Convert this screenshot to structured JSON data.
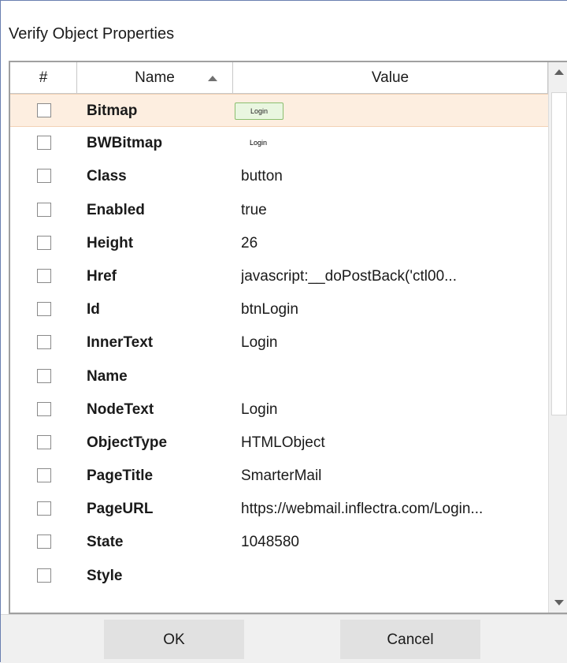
{
  "dialog": {
    "title": "Verify Object Properties"
  },
  "grid": {
    "columns": {
      "index": "#",
      "name": "Name",
      "value": "Value"
    },
    "sort": {
      "column": "Name",
      "direction": "ascending"
    },
    "rows": [
      {
        "name": "Bitmap",
        "value": "Login",
        "kind": "bitmap",
        "selected": true
      },
      {
        "name": "BWBitmap",
        "value": "Login",
        "kind": "bwbitmap"
      },
      {
        "name": "Class",
        "value": "button"
      },
      {
        "name": "Enabled",
        "value": "true"
      },
      {
        "name": "Height",
        "value": "26"
      },
      {
        "name": "Href",
        "value": "javascript:__doPostBack('ctl00..."
      },
      {
        "name": "Id",
        "value": "btnLogin"
      },
      {
        "name": "InnerText",
        "value": "Login"
      },
      {
        "name": "Name",
        "value": ""
      },
      {
        "name": "NodeText",
        "value": "Login"
      },
      {
        "name": "ObjectType",
        "value": "HTMLObject"
      },
      {
        "name": "PageTitle",
        "value": "SmarterMail"
      },
      {
        "name": "PageURL",
        "value": "https://webmail.inflectra.com/Login..."
      },
      {
        "name": "State",
        "value": "1048580"
      },
      {
        "name": "Style",
        "value": ""
      }
    ]
  },
  "buttons": {
    "ok": "OK",
    "cancel": "Cancel"
  }
}
